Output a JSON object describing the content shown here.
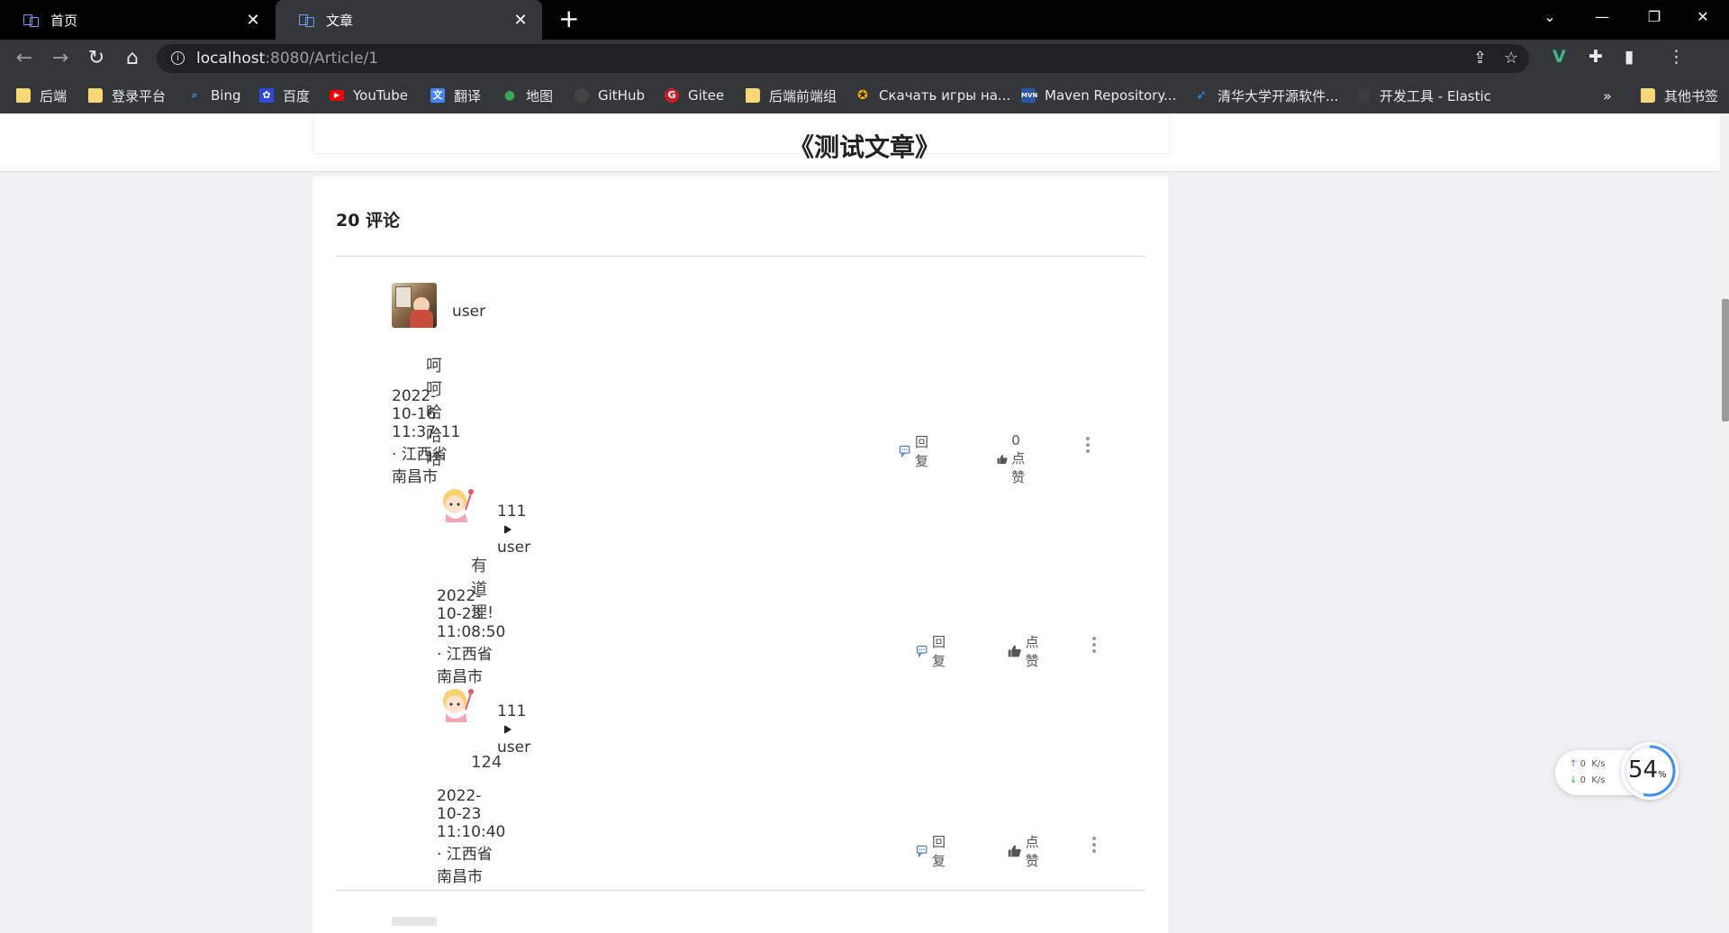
{
  "browser": {
    "tabs": [
      {
        "title": "首页",
        "active": false
      },
      {
        "title": "文章",
        "active": true
      }
    ],
    "url_host": "localhost",
    "url_rest": ":8080/Article/1",
    "bookmarks": [
      {
        "label": "后端",
        "icon": "folder-icon"
      },
      {
        "label": "登录平台",
        "icon": "folder-icon"
      },
      {
        "label": "Bing",
        "icon": "bing-search-icon"
      },
      {
        "label": "百度",
        "icon": "baidu-icon"
      },
      {
        "label": "YouTube",
        "icon": "youtube-icon"
      },
      {
        "label": "翻译",
        "icon": "translate-icon"
      },
      {
        "label": "地图",
        "icon": "map-pin-icon"
      },
      {
        "label": "GitHub",
        "icon": "github-icon"
      },
      {
        "label": "Gitee",
        "icon": "gitee-icon"
      },
      {
        "label": "后端前端组",
        "icon": "folder-icon"
      },
      {
        "label": "Скачать игры на...",
        "icon": "games-icon"
      },
      {
        "label": "Maven Repository...",
        "icon": "maven-icon"
      },
      {
        "label": "清华大学开源软件...",
        "icon": "tsinghua-icon"
      },
      {
        "label": "开发工具 - Elastic",
        "icon": "elastic-icon"
      }
    ],
    "overflow_label": "»",
    "other_bookmarks": "其他书签"
  },
  "page": {
    "title": "《测试文章》",
    "comment_count_label": "20 评论"
  },
  "comments": [
    {
      "author": "user",
      "text": "呵呵哈哈哈",
      "meta": "2022-10-16 11:37:11 · 江西省南昌市",
      "reply_label": "回复",
      "like_label": "0 点赞"
    },
    {
      "author": "111",
      "reply_to": "user",
      "text": "有道理!",
      "meta": "2022-10-23 11:08:50 · 江西省南昌市",
      "reply_label": "回复",
      "like_label": "点赞"
    },
    {
      "author": "111",
      "reply_to": "user",
      "text": "124",
      "meta": "2022-10-23 11:10:40 · 江西省南昌市",
      "reply_label": "回复",
      "like_label": "点赞"
    }
  ],
  "net_widget": {
    "up_value": "0",
    "up_unit": "K/s",
    "down_value": "0",
    "down_unit": "K/s",
    "gauge_value": "54",
    "gauge_unit": "%"
  },
  "colors": {
    "accent": "#3f73d8",
    "chrome_bg": "#35363a",
    "tabbar_bg": "#000000"
  }
}
